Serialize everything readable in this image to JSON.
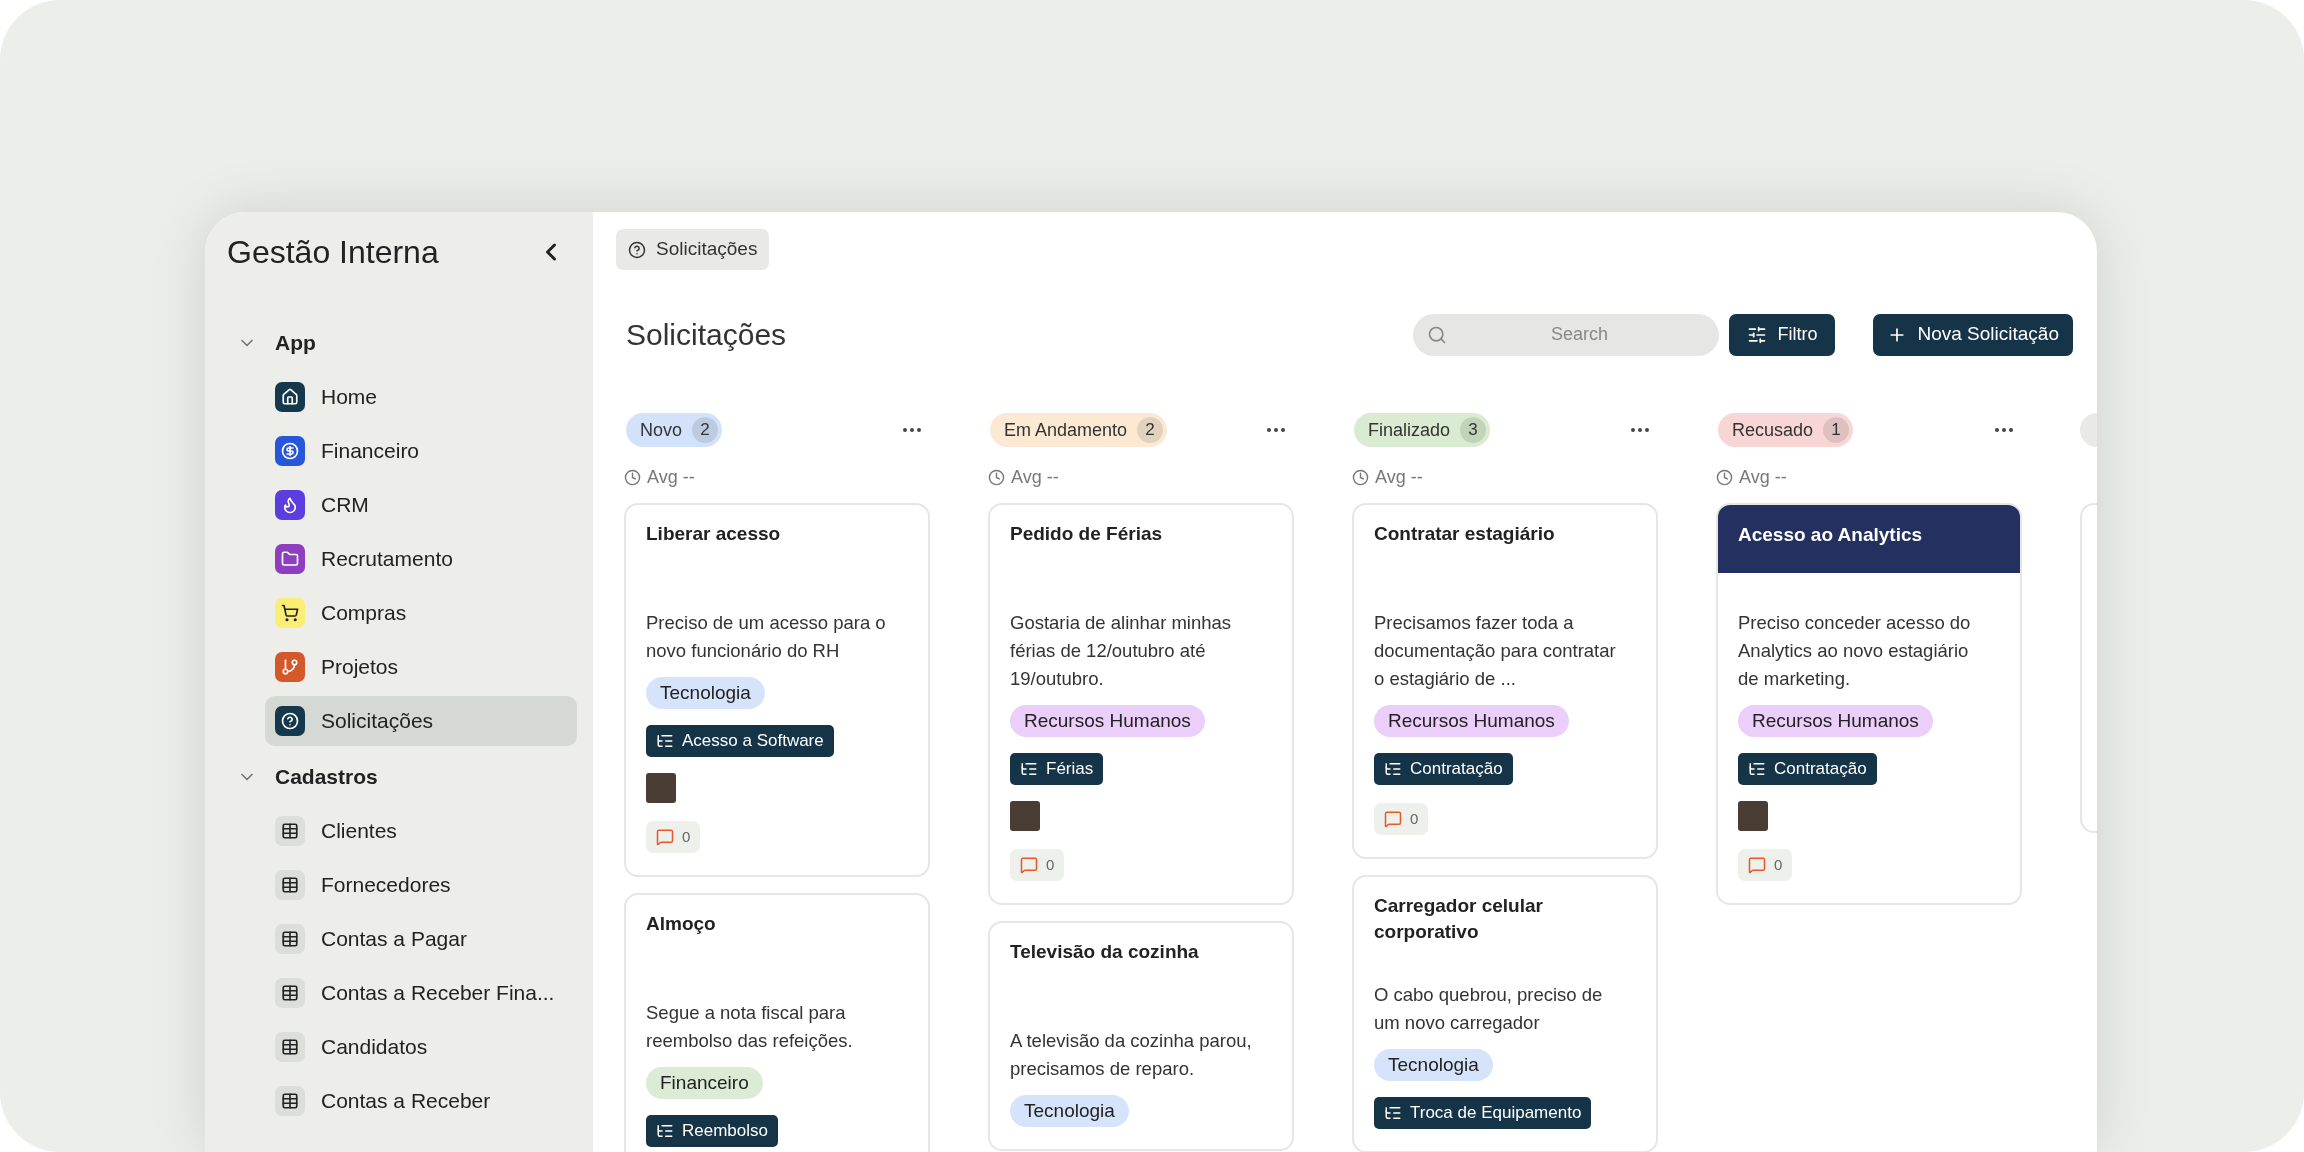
{
  "sidebar": {
    "title": "Gestão Interna",
    "sections": [
      {
        "label": "App",
        "expanded": true,
        "items": [
          {
            "label": "Home",
            "kind": "home",
            "color": "#15384c",
            "selected": false
          },
          {
            "label": "Financeiro",
            "kind": "money",
            "color": "#2656d9",
            "selected": false
          },
          {
            "label": "CRM",
            "kind": "flame",
            "color": "#5b3de0",
            "selected": false
          },
          {
            "label": "Recrutamento",
            "kind": "folder",
            "color": "#8e3fbf",
            "selected": false
          },
          {
            "label": "Compras",
            "kind": "cart",
            "color": "#fbee75",
            "selected": false
          },
          {
            "label": "Projetos",
            "kind": "branch",
            "color": "#d4582a",
            "selected": false
          },
          {
            "label": "Solicitações",
            "kind": "question",
            "color": "#15384c",
            "selected": true
          }
        ]
      },
      {
        "label": "Cadastros",
        "expanded": true,
        "items": [
          {
            "label": "Clientes",
            "kind": "table",
            "color": "#dcdeda",
            "selected": false
          },
          {
            "label": "Fornecedores",
            "kind": "table",
            "color": "#dcdeda",
            "selected": false
          },
          {
            "label": "Contas a Pagar",
            "kind": "table",
            "color": "#dcdeda",
            "selected": false
          },
          {
            "label": "Contas a Receber Fina...",
            "kind": "table",
            "color": "#dcdeda",
            "selected": false
          },
          {
            "label": "Candidatos",
            "kind": "table",
            "color": "#dcdeda",
            "selected": false
          },
          {
            "label": "Contas a Receber",
            "kind": "table",
            "color": "#dcdeda",
            "selected": false
          }
        ]
      }
    ]
  },
  "breadcrumb": "Solicitações",
  "page_title": "Solicitações",
  "search": {
    "placeholder": "Search"
  },
  "filter_button": "Filtro",
  "new_button": "Nova Solicitação",
  "columns": [
    {
      "name": "Novo",
      "count": "2",
      "color": "#d3e2fb",
      "avg": "Avg --",
      "cards": [
        {
          "title": "Liberar acesso",
          "highlighted": false,
          "description": "Preciso de um acesso para o novo funcionário do RH",
          "category": {
            "label": "Tecnologia",
            "color": "#d6e4fb"
          },
          "type": "Acesso a Software",
          "avatar": true,
          "comments": "0"
        },
        {
          "title": "Almoço",
          "highlighted": false,
          "description": "Segue a nota fiscal para reembolso das refeições.",
          "category": {
            "label": "Financeiro",
            "color": "#dcebd5"
          },
          "type": "Reembolso",
          "avatar": false
        }
      ]
    },
    {
      "name": "Em Andamento",
      "count": "2",
      "color": "#fbe9d3",
      "avg": "Avg --",
      "cards": [
        {
          "title": "Pedido de Férias",
          "highlighted": false,
          "description": "Gostaria de alinhar minhas férias de 12/outubro até 19/outubro.",
          "category": {
            "label": "Recursos Humanos",
            "color": "#ebcffa"
          },
          "type": "Férias",
          "avatar": true,
          "comments": "0"
        },
        {
          "title": "Televisão da cozinha",
          "highlighted": false,
          "description": "A televisão da cozinha parou, precisamos de reparo.",
          "category": {
            "label": "Tecnologia",
            "color": "#d6e4fb"
          },
          "avatar": false
        }
      ]
    },
    {
      "name": "Finalizado",
      "count": "3",
      "color": "#d9ebd0",
      "avg": "Avg --",
      "cards": [
        {
          "title": "Contratar estagiário",
          "highlighted": false,
          "description": "Precisamos fazer toda a documentação para contratar o estagiário de ...",
          "category": {
            "label": "Recursos Humanos",
            "color": "#ebcffa"
          },
          "type": "Contratação",
          "avatar": false,
          "comments": "0"
        },
        {
          "title": "Carregador celular corporativo",
          "highlighted": false,
          "description": "O cabo quebrou, preciso de um novo carregador",
          "category": {
            "label": "Tecnologia",
            "color": "#d6e4fb"
          },
          "type": "Troca de Equipamento",
          "avatar": false
        }
      ]
    },
    {
      "name": "Recusado",
      "count": "1",
      "color": "#f9d6d6",
      "avg": "Avg --",
      "cards": [
        {
          "title": "Acesso ao Analytics",
          "highlighted": true,
          "description": "Preciso conceder acesso do Analytics ao novo estagiário de marketing.",
          "category": {
            "label": "Recursos Humanos",
            "color": "#ebcffa"
          },
          "type": "Contratação",
          "avatar": true,
          "comments": "0"
        }
      ]
    }
  ]
}
